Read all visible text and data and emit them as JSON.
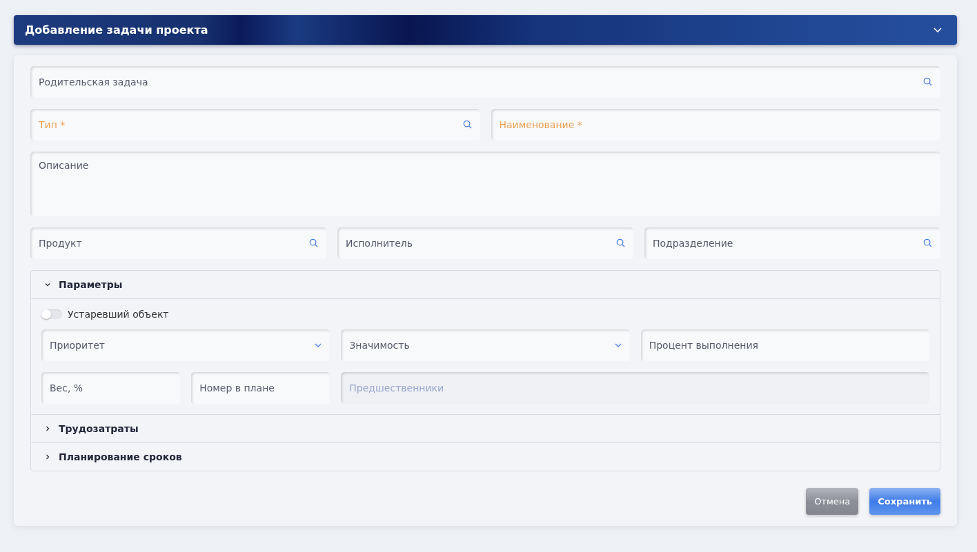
{
  "header": {
    "title": "Добавление задачи проекта"
  },
  "field_lines": [
    [
      {
        "placeholder": "Родительская задача",
        "kind": "lookup",
        "required": false
      }
    ],
    [
      {
        "placeholder": "Тип *",
        "kind": "lookup",
        "required": true
      },
      {
        "placeholder": "Наименование *",
        "kind": "text",
        "required": true
      }
    ],
    [
      {
        "placeholder": "Описание",
        "kind": "textarea",
        "required": false
      }
    ],
    [
      {
        "placeholder": "Продукт",
        "kind": "lookup",
        "required": false
      },
      {
        "placeholder": "Исполнитель",
        "kind": "lookup",
        "required": false
      },
      {
        "placeholder": "Подразделение",
        "kind": "lookup",
        "required": false
      }
    ]
  ],
  "sections": [
    {
      "title": "Параметры",
      "expanded": true,
      "toggle": {
        "label": "Устаревший объект",
        "on": false
      },
      "lines": [
        [
          {
            "placeholder": "Приоритет",
            "kind": "select",
            "disabled": false
          },
          {
            "placeholder": "Значимость",
            "kind": "select",
            "disabled": false
          },
          {
            "placeholder": "Процент выполнения",
            "kind": "text",
            "disabled": false
          }
        ],
        [
          {
            "placeholder": "Вес, %",
            "kind": "text",
            "disabled": false
          },
          {
            "placeholder": "Номер в плане",
            "kind": "text",
            "disabled": false
          },
          {
            "placeholder": "Предшественники",
            "kind": "text",
            "disabled": true
          }
        ]
      ]
    },
    {
      "title": "Трудозатраты",
      "expanded": false
    },
    {
      "title": "Планирование сроков",
      "expanded": false
    }
  ],
  "buttons": [
    {
      "label": "Отмена",
      "kind": "secondary"
    },
    {
      "label": "Сохранить",
      "kind": "primary"
    }
  ]
}
